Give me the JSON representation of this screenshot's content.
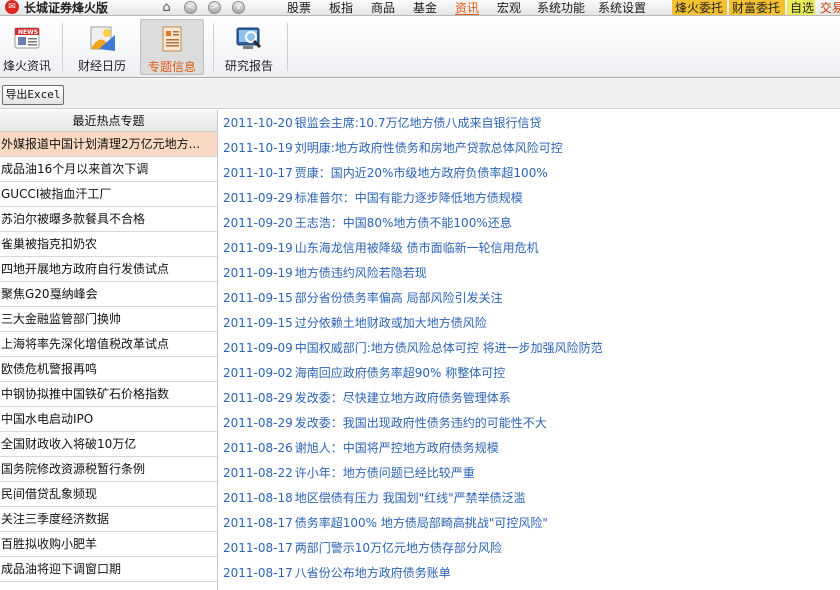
{
  "app": {
    "logo": "✉",
    "title": "长城证券烽火版"
  },
  "nav": {
    "home_icon": "home-icon",
    "buttons": [
      "<",
      ">",
      "v"
    ]
  },
  "menu": {
    "items": [
      "股票",
      "板指",
      "商品",
      "基金",
      "资讯",
      "宏观",
      "系统功能",
      "系统设置"
    ],
    "active": "资讯"
  },
  "hot": {
    "b1": "烽火委托",
    "b2": "财富委托",
    "b3": "自选",
    "b4": "交易"
  },
  "toolbar": {
    "items": [
      {
        "label": "烽火资讯",
        "icon": "news-icon"
      },
      {
        "label": "财经日历",
        "icon": "calendar-icon"
      },
      {
        "label": "专题信息",
        "icon": "topic-icon"
      },
      {
        "label": "研究报告",
        "icon": "report-search-icon"
      }
    ],
    "selected": "专题信息"
  },
  "actions": {
    "export_label": "导出Excel"
  },
  "topics": {
    "header": "最近热点专题",
    "items": [
      "外媒报道中国计划清理2万亿元地方...",
      "成品油16个月以来首次下调",
      "GUCCI被指血汗工厂",
      "苏泊尔被曝多款餐具不合格",
      "雀巢被指克扣奶农",
      "四地开展地方政府自行发债试点",
      "聚焦G20戛纳峰会",
      "三大金融监管部门换帅",
      "上海将率先深化增值税改革试点",
      "欧债危机警报再鸣",
      "中钢协拟推中国铁矿石价格指数",
      "中国水电启动IPO",
      "全国财政收入将破10万亿",
      "国务院修改资源税暂行条例",
      "民间借贷乱象频现",
      "关注三季度经济数据",
      "百胜拟收购小肥羊",
      "成品油将迎下调窗口期"
    ]
  },
  "news": {
    "items": [
      {
        "date": "2011-10-20",
        "title": "银监会主席:10.7万亿地方债八成来自银行信贷"
      },
      {
        "date": "2011-10-19",
        "title": "刘明康:地方政府性债务和房地产贷款总体风险可控"
      },
      {
        "date": "2011-10-17",
        "title": "贾康：国内近20%市级地方政府负债率超100%"
      },
      {
        "date": "2011-09-29",
        "title": "标准普尔：中国有能力逐步降低地方债规模"
      },
      {
        "date": "2011-09-20",
        "title": "王志浩：中国80%地方债不能100%还息"
      },
      {
        "date": "2011-09-19",
        "title": "山东海龙信用被降级 债市面临新一轮信用危机"
      },
      {
        "date": "2011-09-19",
        "title": "地方债违约风险若隐若现"
      },
      {
        "date": "2011-09-15",
        "title": "部分省份债务率偏高 局部风险引发关注"
      },
      {
        "date": "2011-09-15",
        "title": "过分依赖土地财政或加大地方债风险"
      },
      {
        "date": "2011-09-09",
        "title": "中国权威部门:地方债风险总体可控 将进一步加强风险防范"
      },
      {
        "date": "2011-09-02",
        "title": "海南回应政府债务率超90% 称整体可控"
      },
      {
        "date": "2011-08-29",
        "title": "发改委：尽快建立地方政府债务管理体系"
      },
      {
        "date": "2011-08-29",
        "title": "发改委：我国出现政府性债务违约的可能性不大"
      },
      {
        "date": "2011-08-26",
        "title": "谢旭人：中国将严控地方政府债务规模"
      },
      {
        "date": "2011-08-22",
        "title": "许小年：地方债问题已经比较严重"
      },
      {
        "date": "2011-08-18",
        "title": "地区偿债有压力 我国划\"红线\"严禁举债泛滥"
      },
      {
        "date": "2011-08-17",
        "title": "债务率超100% 地方债局部畸高挑战\"可控风险\""
      },
      {
        "date": "2011-08-17",
        "title": "两部门警示10万亿元地方债存部分风险"
      },
      {
        "date": "2011-08-17",
        "title": "八省份公布地方政府债务账单"
      }
    ]
  }
}
